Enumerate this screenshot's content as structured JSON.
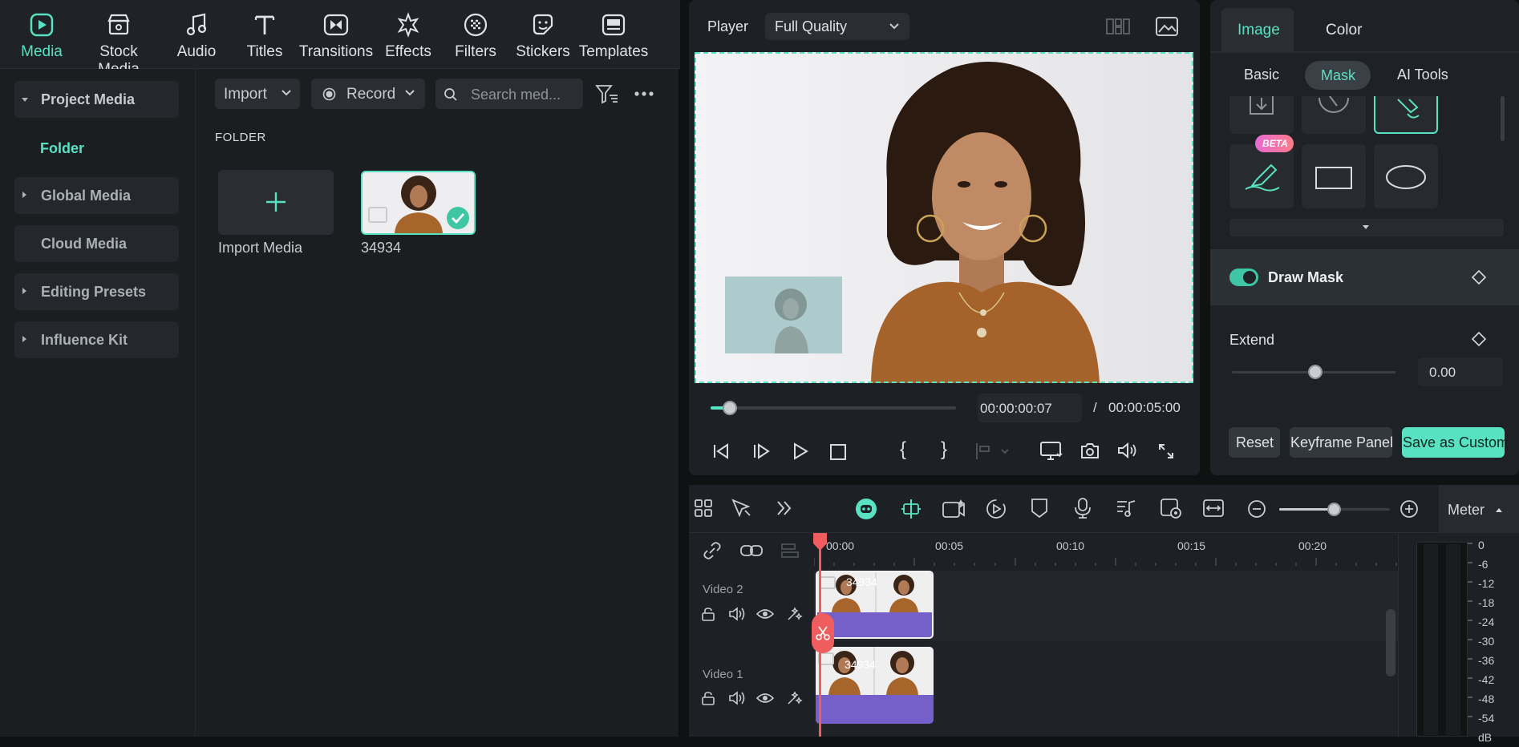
{
  "top_tabs": [
    {
      "label": "Media",
      "icon": "media-icon"
    },
    {
      "label": "Stock Media",
      "icon": "stock-media-icon"
    },
    {
      "label": "Audio",
      "icon": "audio-icon"
    },
    {
      "label": "Titles",
      "icon": "titles-icon"
    },
    {
      "label": "Transitions",
      "icon": "transitions-icon"
    },
    {
      "label": "Effects",
      "icon": "effects-icon"
    },
    {
      "label": "Filters",
      "icon": "filters-icon"
    },
    {
      "label": "Stickers",
      "icon": "stickers-icon"
    },
    {
      "label": "Templates",
      "icon": "templates-icon"
    }
  ],
  "sidebar": {
    "items": [
      {
        "label": "Project Media",
        "expanded": true
      },
      {
        "label": "Folder"
      },
      {
        "label": "Global Media"
      },
      {
        "label": "Cloud Media"
      },
      {
        "label": "Editing Presets"
      },
      {
        "label": "Influence Kit"
      }
    ]
  },
  "media": {
    "import_label": "Import",
    "record_label": "Record",
    "search_placeholder": "Search med...",
    "folder_label": "FOLDER",
    "import_media_label": "Import Media",
    "clip_name": "34934"
  },
  "player": {
    "label": "Player",
    "quality": "Full Quality",
    "current_time": "00:00:00:07",
    "separator": "/",
    "total_time": "00:00:05:00"
  },
  "inspector": {
    "tabs": [
      "Image",
      "Color"
    ],
    "subtabs": [
      "Basic",
      "Mask",
      "AI Tools"
    ],
    "beta_badge": "BETA",
    "draw_mask_label": "Draw Mask",
    "extend_label": "Extend",
    "extend_value": "0.00",
    "reset_label": "Reset",
    "keyframe_label": "Keyframe Panel",
    "save_label": "Save as Custom"
  },
  "timeline": {
    "meter_label": "Meter",
    "ruler": [
      "00:00",
      "00:05",
      "00:10",
      "00:15",
      "00:20"
    ],
    "tracks": [
      {
        "name": "Video 2",
        "clip": "34934"
      },
      {
        "name": "Video 1",
        "clip": "34934"
      }
    ],
    "meter_scale": [
      "0",
      "-6",
      "-12",
      "-18",
      "-24",
      "-30",
      "-36",
      "-42",
      "-48",
      "-54",
      "dB"
    ]
  },
  "colors": {
    "accent": "#59e2c2",
    "clip_purple": "#7560c9",
    "playhead": "#f05d5e"
  }
}
